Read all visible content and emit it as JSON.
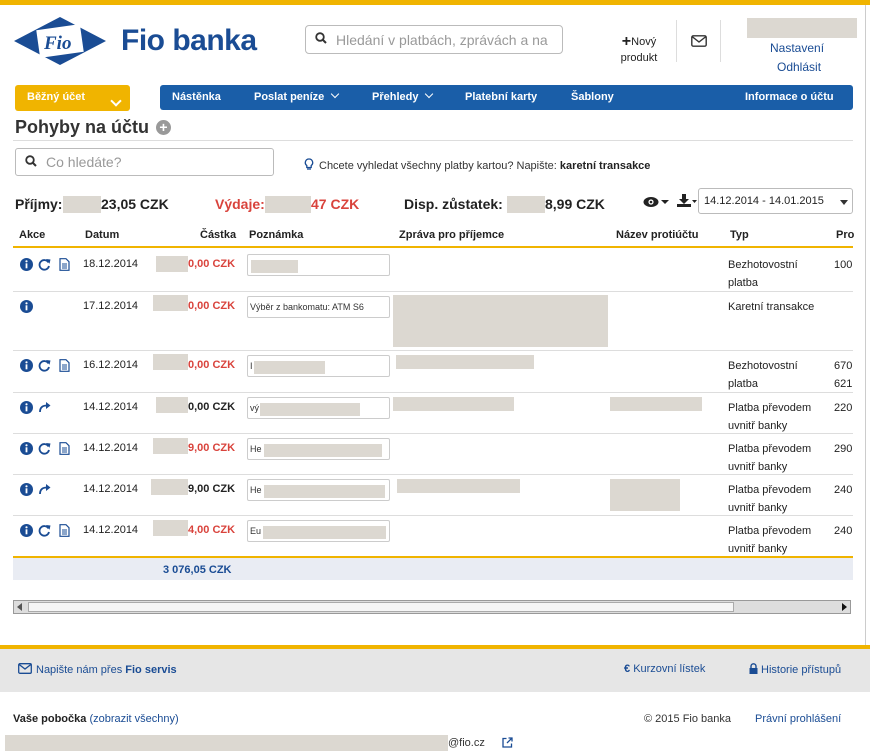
{
  "brand": "Fio banka",
  "logo_text": "Fio",
  "colors": {
    "brand_blue": "#1a4c94",
    "nav_blue": "#1a5ea8",
    "accent_yellow": "#f0b400",
    "negative_red": "#d9433c"
  },
  "header": {
    "search_placeholder": "Hledání v platbách, zprávách a na",
    "new_product_label": "Nový produkt",
    "settings_label": "Nastavení",
    "logout_label": "Odhlásit"
  },
  "account_selector": {
    "label": "Běžný účet"
  },
  "nav": {
    "items": [
      {
        "label": "Nástěnka"
      },
      {
        "label": "Poslat peníze"
      },
      {
        "label": "Přehledy"
      },
      {
        "label": "Platební karty"
      },
      {
        "label": "Šablony"
      },
      {
        "label": "Informace o účtu"
      }
    ]
  },
  "page": {
    "title": "Pohyby na účtu",
    "search_placeholder": "Co hledáte?",
    "tip_text": "Chcete vyhledat všechny platby kartou? Napište:",
    "tip_keyword": "karetní transakce"
  },
  "summary": {
    "income_label": "Příjmy:",
    "income_value": "23,05 CZK",
    "expense_label": "Výdaje:",
    "expense_value": "47 CZK",
    "balance_label": "Disp. zůstatek:",
    "balance_value": "8,99 CZK",
    "date_range": "14.12.2014 - 14.01.2015"
  },
  "table": {
    "columns": [
      "Akce",
      "Datum",
      "Částka",
      "Poznámka",
      "Zpráva pro příjemce",
      "Název protiúčtu",
      "Typ",
      "Pro"
    ],
    "rows": [
      {
        "date": "18.12.2014",
        "amount": "0,00 CZK",
        "note": "",
        "type1": "Bezhotovostní",
        "type2": "platba",
        "pro1": "100",
        "pro2": ""
      },
      {
        "date": "17.12.2014",
        "amount": "0,00 CZK",
        "note": "Výběr z bankomatu: ATM S6",
        "type1": "Karetní transakce",
        "type2": "",
        "pro1": "",
        "pro2": ""
      },
      {
        "date": "16.12.2014",
        "amount": "0,00 CZK",
        "note": "I",
        "type1": "Bezhotovostní",
        "type2": "platba",
        "pro1": "670",
        "pro2": "621"
      },
      {
        "date": "14.12.2014",
        "amount": "0,00 CZK",
        "note": "vý",
        "type1": "Platba převodem",
        "type2": "uvnitř banky",
        "pro1": "220",
        "pro2": ""
      },
      {
        "date": "14.12.2014",
        "amount": "9,00 CZK",
        "note": "He",
        "type1": "Platba převodem",
        "type2": "uvnitř banky",
        "pro1": "290",
        "pro2": ""
      },
      {
        "date": "14.12.2014",
        "amount": "9,00 CZK",
        "note": "He",
        "type1": "Platba převodem",
        "type2": "uvnitř banky",
        "pro1": "240",
        "pro2": ""
      },
      {
        "date": "14.12.2014",
        "amount": "4,00 CZK",
        "note": "Eu",
        "type1": "Platba převodem",
        "type2": "uvnitř banky",
        "pro1": "240",
        "pro2": ""
      }
    ],
    "total": "3 076,05 CZK"
  },
  "footer": {
    "contact_prefix": "Napište nám přes",
    "contact_service": "Fio servis",
    "rates_label": "Kurzovní lístek",
    "history_label": "Historie přístupů",
    "branch_label": "Vaše pobočka",
    "branch_link": "(zobrazit všechny)",
    "copyright": "© 2015 Fio banka",
    "legal_link": "Právní prohlášení",
    "email_suffix": "@fio.cz"
  }
}
